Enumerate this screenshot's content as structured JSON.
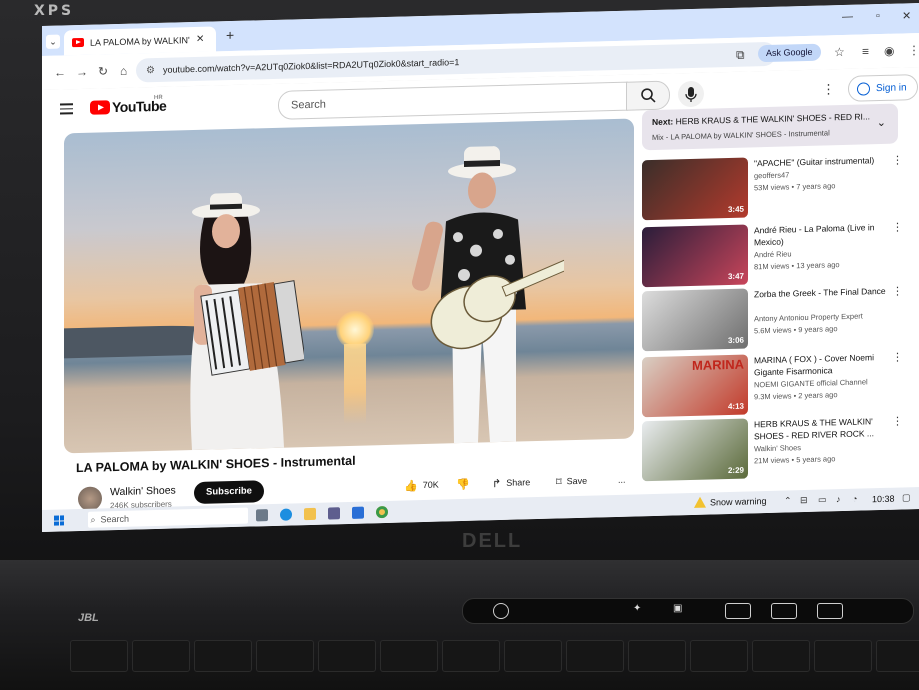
{
  "laptop": {
    "brand_top": "XPS",
    "brand_bottom": "DELL",
    "speaker": "JBL",
    "media_icons": [
      "power-icon",
      "wifi-icon",
      "lock-icon",
      "eject-icon",
      "wireless-icon",
      "waves-icon"
    ]
  },
  "browser": {
    "tab_title": "LA PALOMA by WALKIN' SH",
    "url": "youtube.com/watch?v=A2UTq0Ziok0&list=RDA2UTq0Ziok0&start_radio=1",
    "ask_google": "Ask Google"
  },
  "youtube": {
    "logo_text": "YouTube",
    "region": "HR",
    "search_placeholder": "Search",
    "sign_in": "Sign in"
  },
  "video": {
    "title": "LA PALOMA by WALKIN' SHOES - Instrumental",
    "channel": "Walkin' Shoes",
    "subscribers": "246K subscribers",
    "subscribe": "Subscribe",
    "likes": "70K",
    "share": "Share",
    "save": "Save",
    "more": "..."
  },
  "up_next": {
    "prefix": "Next:",
    "title": "HERB KRAUS & THE WALKIN' SHOES - RED RI...",
    "subtitle": "Mix - LA PALOMA by WALKIN' SHOES - Instrumental"
  },
  "recommendations": [
    {
      "title": "\"APACHE\" (Guitar instrumental)",
      "channel": "geoffers47",
      "meta": "53M views • 7 years ago",
      "duration": "3:45",
      "colors": [
        "#3a2e2a",
        "#b33a2c"
      ]
    },
    {
      "title": "André Rieu - La Paloma (Live in Mexico)",
      "channel": "André Rieu",
      "meta": "81M views • 13 years ago",
      "duration": "3:47",
      "colors": [
        "#2a1d3a",
        "#c8455a"
      ]
    },
    {
      "title": "Zorba  the Greek - The Final Dance",
      "channel": "Antony Antoniou Property Expert",
      "meta": "5.6M views • 9 years ago",
      "duration": "3:06",
      "colors": [
        "#dcdcdc",
        "#6e6e6e"
      ]
    },
    {
      "title": "MARINA ( FOX ) - Cover Noemi Gigante Fisarmonica",
      "channel": "NOEMI GIGANTE official Channel",
      "meta": "9.3M views • 2 years ago",
      "duration": "4:13",
      "thumb_text": "MARINA",
      "colors": [
        "#d9cfc4",
        "#c23a2a"
      ]
    },
    {
      "title": "HERB KRAUS & THE WALKIN' SHOES - RED RIVER ROCK ...",
      "channel": "Walkin' Shoes",
      "meta": "21M views • 5 years ago",
      "duration": "2:29",
      "colors": [
        "#e9ecef",
        "#5b6a3a"
      ]
    }
  ],
  "taskbar": {
    "search": "Search",
    "weather": "Snow warning",
    "time": "10:38"
  },
  "colors": {
    "youtube_red": "#ff0000",
    "chrome_blue": "#d3e3fd",
    "link_blue": "#065fd4"
  }
}
